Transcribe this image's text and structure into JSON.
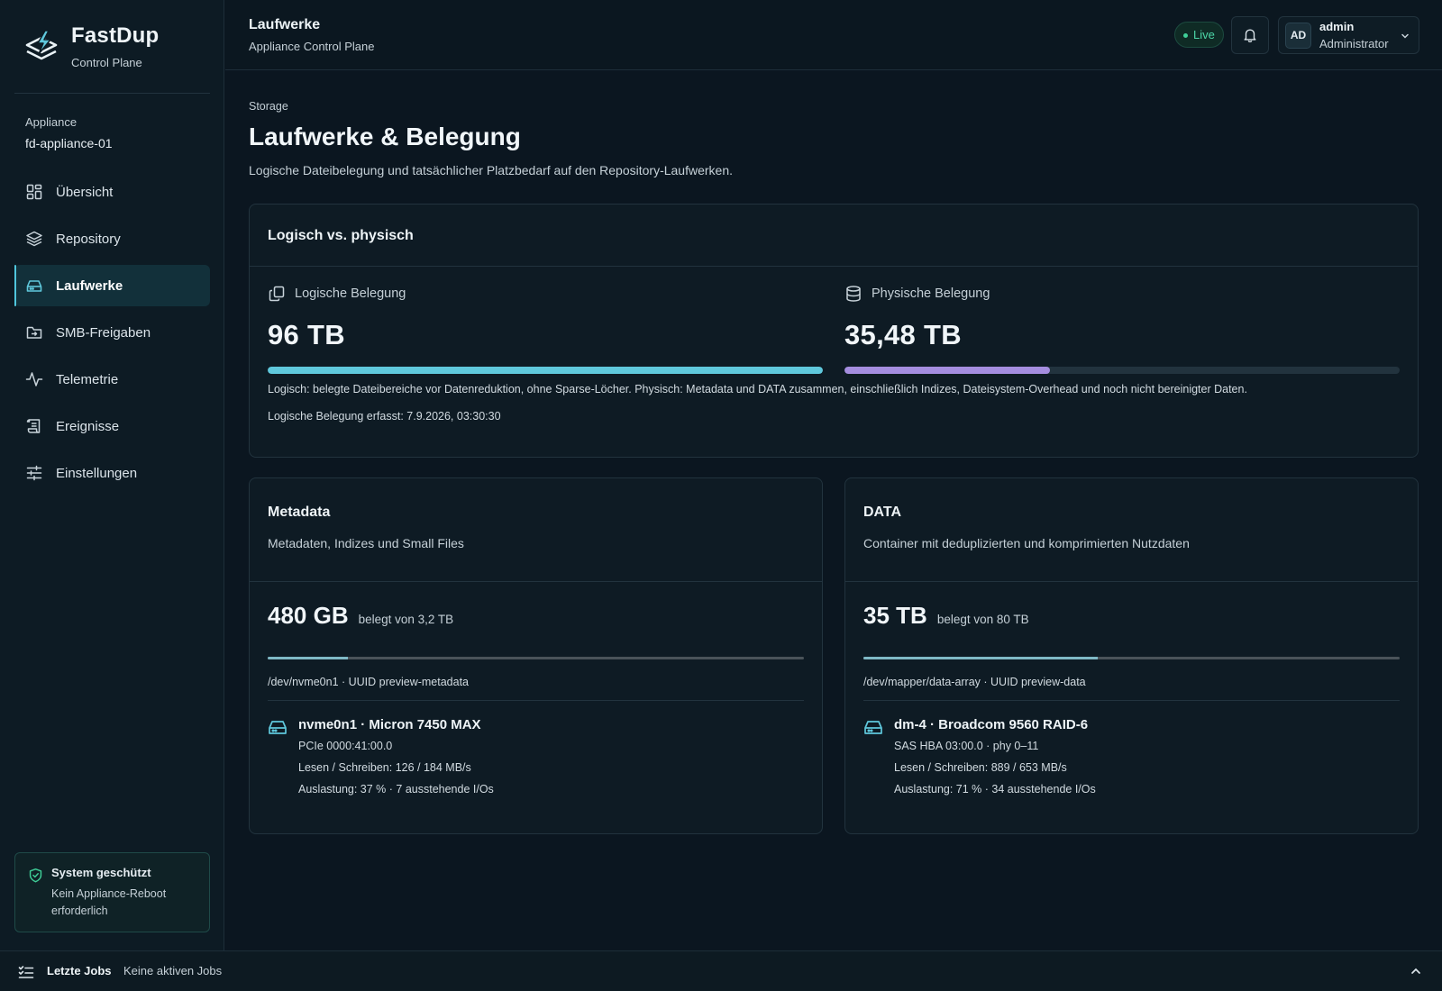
{
  "brand": {
    "name": "FastDup",
    "subtitle": "Control Plane"
  },
  "appliance": {
    "label": "Appliance",
    "name": "fd-appliance-01"
  },
  "nav": {
    "items": [
      {
        "label": "Übersicht",
        "icon": "dashboard-icon"
      },
      {
        "label": "Repository",
        "icon": "layers-icon"
      },
      {
        "label": "Laufwerke",
        "icon": "drive-icon",
        "active": true
      },
      {
        "label": "SMB-Freigaben",
        "icon": "folder-share-icon"
      },
      {
        "label": "Telemetrie",
        "icon": "activity-icon"
      },
      {
        "label": "Ereignisse",
        "icon": "scroll-icon"
      },
      {
        "label": "Einstellungen",
        "icon": "sliders-icon"
      }
    ]
  },
  "system_status": {
    "title": "System geschützt",
    "text": "Kein Appliance-Reboot erforderlich"
  },
  "topbar": {
    "title": "Laufwerke",
    "subtitle": "Appliance Control Plane",
    "live_label": "Live",
    "user": {
      "initials": "AD",
      "name": "admin",
      "role": "Administrator"
    }
  },
  "page": {
    "breadcrumb": "Storage",
    "title": "Laufwerke & Belegung",
    "description": "Logische Dateibelegung und tatsächlicher Platzbedarf auf den Repository-Laufwerken."
  },
  "overview": {
    "title": "Logisch vs. physisch",
    "logical": {
      "label": "Logische Belegung",
      "value": "96 TB",
      "fill_fraction": 1.0,
      "color": "#5fc8dc"
    },
    "physical": {
      "label": "Physische Belegung",
      "value": "35,48 TB",
      "fill_fraction": 0.37,
      "color": "#a48ddf"
    },
    "note": "Logisch: belegte Dateibereiche vor Datenreduktion, ohne Sparse-Löcher. Physisch: Metadata und DATA zusammen, einschließlich Indizes, Dateisystem-Overhead und noch nicht bereinigter Daten.",
    "captured": "Logische Belegung erfasst: 7.9.2026, 03:30:30"
  },
  "volumes": [
    {
      "title": "Metadata",
      "description": "Metadaten, Indizes und Small Files",
      "used": "480 GB",
      "capacity_text": "belegt von 3,2 TB",
      "fill_fraction": 0.15,
      "path": "/dev/nvme0n1 · UUID preview-metadata",
      "device": {
        "title": "nvme0n1 · Micron 7450 MAX",
        "bus": "PCIe 0000:41:00.0",
        "throughput": "Lesen / Schreiben: 126 / 184 MB/s",
        "load": "Auslastung: 37 % · 7 ausstehende I/Os"
      }
    },
    {
      "title": "DATA",
      "description": "Container mit deduplizierten und komprimierten Nutzdaten",
      "used": "35 TB",
      "capacity_text": "belegt von 80 TB",
      "fill_fraction": 0.4375,
      "path": "/dev/mapper/data-array · UUID preview-data",
      "device": {
        "title": "dm-4 · Broadcom 9560 RAID-6",
        "bus": "SAS HBA 03:00.0 · phy 0–11",
        "throughput": "Lesen / Schreiben: 889 / 653 MB/s",
        "load": "Auslastung: 71 % · 34 ausstehende I/Os"
      }
    }
  ],
  "jobs": {
    "label": "Letzte Jobs",
    "status": "Keine aktiven Jobs"
  },
  "colors": {
    "accent": "#4fc6dc",
    "live": "#3fcf98",
    "status_ok": "#3fcf98"
  }
}
